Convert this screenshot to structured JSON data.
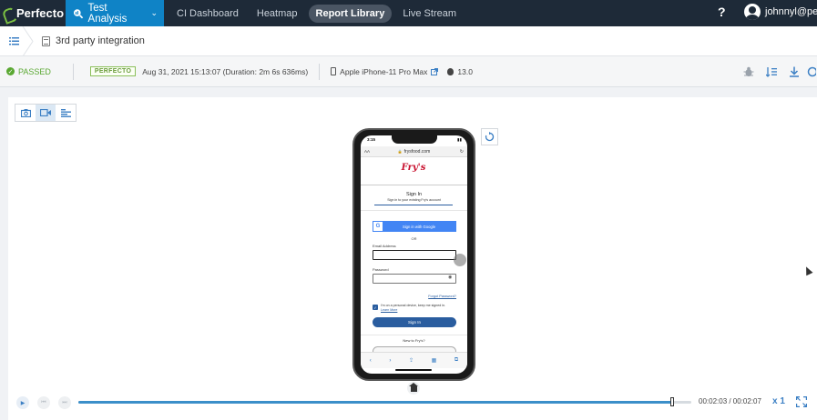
{
  "topnav": {
    "logo": "Perfecto",
    "app_select": "Test Analysis",
    "tabs": [
      "CI Dashboard",
      "Heatmap",
      "Report Library",
      "Live Stream"
    ],
    "active_tab": "Report Library",
    "help": "?",
    "user": "johnnyl@per..."
  },
  "breadcrumb": {
    "title": "3rd party integration"
  },
  "info": {
    "status": "PASSED",
    "badge": "PERFECTO",
    "date": "Aug 31, 2021 15:13:07 (Duration: 2m 6s 636ms)",
    "device": "Apple iPhone-11 Pro Max",
    "os_version": "13.0"
  },
  "phone_screen": {
    "time": "3:15",
    "url_aa": "AA",
    "url": "frysfood.com",
    "brand": "Fry's",
    "signin_title": "Sign In",
    "signin_sub": "Sign in to your existing Fry's account",
    "google_g": "G",
    "google_button": "Sign in with Google",
    "or": "OR",
    "email_label": "Email Address",
    "password_label": "Password",
    "forgot": "Forgot Password?",
    "keep_signed": "I'm on a personal device, keep me signed in.",
    "learn_more": "Learn More",
    "signin_button": "Sign In",
    "new_to": "New to Fry's?"
  },
  "playback": {
    "time": "00:02:03 / 00:02:07",
    "progress": 0.969,
    "speed": "x 1"
  },
  "colors": {
    "nav_bg": "#1e2a38",
    "accent": "#0f83c6",
    "passed": "#5aa832",
    "link": "#3b7fc4"
  }
}
